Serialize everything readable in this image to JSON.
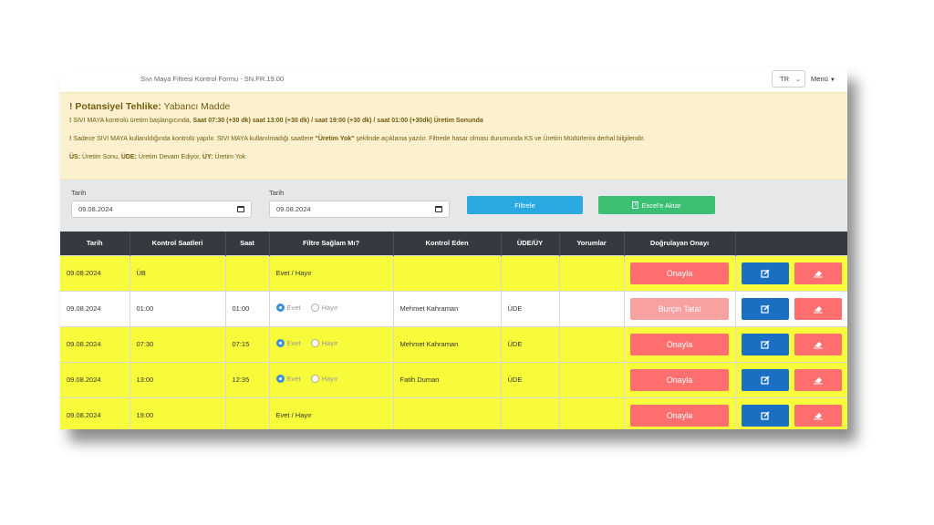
{
  "header": {
    "form_title": "Sıvı Maya Filtresi Kontrol Formu - SN.FR.19.00",
    "language": "TR",
    "menu_label": "Menü"
  },
  "warning": {
    "title_prefix": "Potansiyel Tehlike:",
    "title_rest": " Yabancı Madde",
    "line1_normal": "SIVI MAYA kontrolü üretim başlangıcında, ",
    "line1_bold": "Saat 07:30 (+30 dk) saat 13:00 (+30 dk) / saat 19:00 (+30 dk) / saat 01:00 (+30dk) Üretim Sonunda",
    "line2_a": "Sadece SIVI MAYA kullanıldığında kontrolü yapılır. SIVI MAYA kullanılmadığı saatlere ",
    "line2_bold": "\"Üretim Yok\"",
    "line2_b": " şeklinde açıklama yazılır. Filtrede hasar olması durumunda KS ve Üretim Müdürlerini derhal bilgilendir.",
    "legend_us_key": "ÜS:",
    "legend_us_val": " Üretim Sonu, ",
    "legend_ude_key": "ÜDE:",
    "legend_ude_val": " Üretim Devam Ediyor, ",
    "legend_uy_key": "ÜY:",
    "legend_uy_val": " Üretim Yok"
  },
  "filters": {
    "from_label": "Tarih",
    "from_value": "09.08.2024",
    "to_label": "Tarih",
    "to_value": "09.08.2024",
    "filter_button": "Filtrele",
    "excel_button": "Excel'e Aktar"
  },
  "table": {
    "headers": [
      "Tarih",
      "Kontrol Saatleri",
      "Saat",
      "Filtre Sağlam Mı?",
      "Kontrol Eden",
      "ÜDE/ÜY",
      "Yorumlar",
      "Doğrulayan Onayı",
      ""
    ],
    "radio_yes": "Evet",
    "radio_no": "Hayır",
    "rows": [
      {
        "date": "09.08.2024",
        "control": "ÜB",
        "time": "",
        "filter_text": "Evet / Hayır",
        "checker": "",
        "status": "",
        "comment": "",
        "approval": "Onayla"
      },
      {
        "date": "09.08.2024",
        "control": "01:00",
        "time": "01:00",
        "filter_text": "",
        "checker": "Mehmet Kahraman",
        "status": "ÜDE",
        "comment": "",
        "approval": "Burçin Tatal"
      },
      {
        "date": "09.08.2024",
        "control": "07:30",
        "time": "07:15",
        "filter_text": "",
        "checker": "Mehmet Kahraman",
        "status": "ÜDE",
        "comment": "",
        "approval": "Onayla"
      },
      {
        "date": "09.08.2024",
        "control": "13:00",
        "time": "12:35",
        "filter_text": "",
        "checker": "Fatih Duman",
        "status": "ÜDE",
        "comment": "",
        "approval": "Onayla"
      },
      {
        "date": "09.08.2024",
        "control": "19:00",
        "time": "",
        "filter_text": "Evet / Hayır",
        "checker": "",
        "status": "",
        "comment": "",
        "approval": "Onayla"
      }
    ]
  },
  "colors": {
    "row_highlight": "#f7fb3a",
    "header_dark": "#343a40",
    "approve_red": "#ff6f6f",
    "edit_blue": "#1a6fc2",
    "filter_blue": "#2aa8e0",
    "excel_green": "#3bbf73",
    "warning_bg": "#fcf1cf"
  },
  "icons": {
    "edit": "edit-icon",
    "delete": "eraser-icon",
    "calendar": "calendar-icon",
    "excel": "excel-icon",
    "select": "chevron-down-icon"
  }
}
